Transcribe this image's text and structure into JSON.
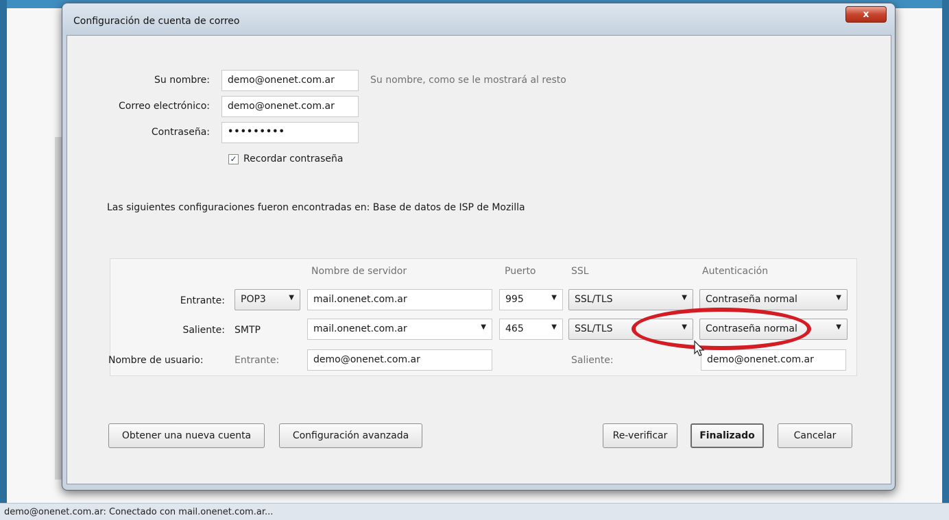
{
  "dialog": {
    "title": "Configuración de cuenta de correo",
    "close_label": "x"
  },
  "identity": {
    "name_label": "Su nombre:",
    "name_value": "demo@onenet.com.ar",
    "name_hint": "Su nombre, como se le mostrará al resto",
    "email_label": "Correo electrónico:",
    "email_value": "demo@onenet.com.ar",
    "password_label": "Contraseña:",
    "password_value": "•••••••••",
    "remember_label": "Recordar contraseña",
    "remember_checked": true
  },
  "found_message": "Las siguientes configuraciones fueron encontradas en: Base de datos de ISP de Mozilla",
  "server_config": {
    "headers": {
      "server": "Nombre de servidor",
      "port": "Puerto",
      "ssl": "SSL",
      "auth": "Autenticación"
    },
    "incoming": {
      "label": "Entrante:",
      "protocol": "POP3",
      "server": "mail.onenet.com.ar",
      "port": "995",
      "ssl": "SSL/TLS",
      "auth": "Contraseña normal"
    },
    "outgoing": {
      "label": "Saliente:",
      "protocol": "SMTP",
      "server": "mail.onenet.com.ar",
      "port": "465",
      "ssl": "SSL/TLS",
      "auth": "Contraseña normal"
    },
    "username": {
      "label": "Nombre de usuario:",
      "incoming_label": "Entrante:",
      "incoming_value": "demo@onenet.com.ar",
      "outgoing_label": "Saliente:",
      "outgoing_value": "demo@onenet.com.ar"
    }
  },
  "buttons": {
    "new_account": "Obtener una nueva cuenta",
    "advanced": "Configuración avanzada",
    "recheck": "Re-verificar",
    "done": "Finalizado",
    "cancel": "Cancelar"
  },
  "status_bar": "demo@onenet.com.ar: Conectado con mail.onenet.com.ar...",
  "colors": {
    "highlight_ellipse": "#d41c24",
    "desktop": "#3f8ec0"
  }
}
